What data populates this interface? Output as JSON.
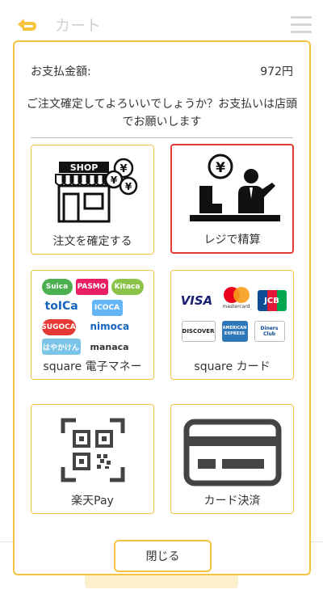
{
  "header": {
    "title": "カート"
  },
  "modal": {
    "amount_label": "お支払金額:",
    "amount_value": "972円",
    "message": "ご注文確定してよろいいでしょうか？お支払いは店頭でお願いします",
    "close_label": "閉じる",
    "options": [
      {
        "label": "注文を確定する",
        "icon": "shop-yen-icon",
        "selected": false
      },
      {
        "label": "レジで精算",
        "icon": "register-payment-icon",
        "selected": true
      },
      {
        "label": "square 電子マネー",
        "icon": "emoney-logos-icon",
        "selected": false
      },
      {
        "label": "square カード",
        "icon": "credit-card-logos-icon",
        "selected": false
      },
      {
        "label": "楽天Pay",
        "icon": "qr-code-icon",
        "selected": false
      },
      {
        "label": "カード決済",
        "icon": "credit-card-icon",
        "selected": false
      }
    ],
    "emoney_brands": [
      "Suica",
      "PASMO",
      "Kitaca",
      "toICa",
      "SUGOCA",
      "nimoca",
      "はやかけん",
      "manaca",
      "ICOCA"
    ],
    "card_brands": [
      "VISA",
      "mastercard",
      "JCB",
      "DISCOVER",
      "AMERICAN EXPRESS",
      "Diners Club"
    ]
  },
  "colors": {
    "accent": "#f5c342",
    "selected_border": "#e53935"
  }
}
